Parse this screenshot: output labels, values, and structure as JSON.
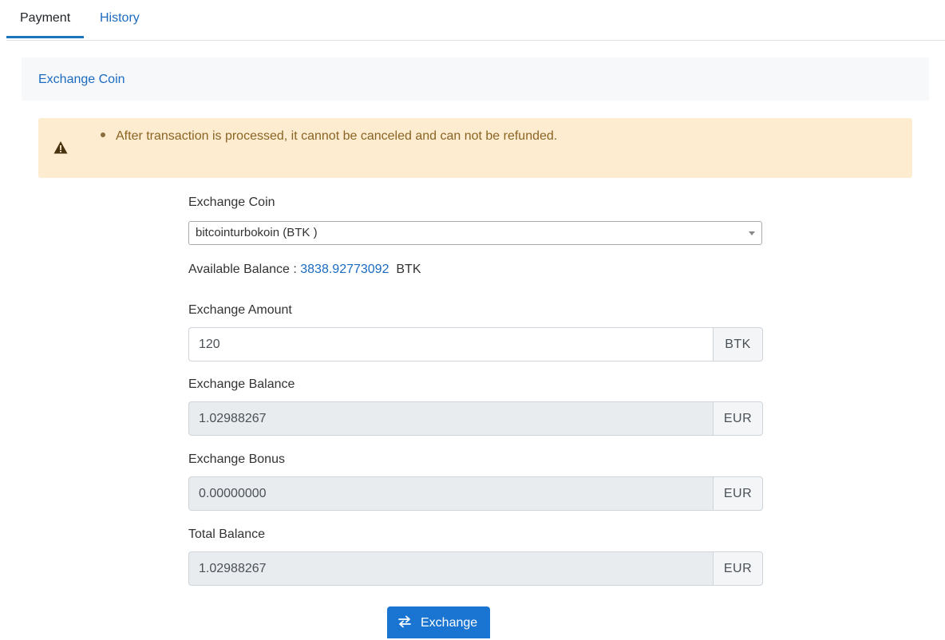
{
  "tabs": [
    {
      "label": "Payment",
      "active": true
    },
    {
      "label": "History",
      "active": false
    }
  ],
  "card": {
    "title": "Exchange Coin"
  },
  "alert": {
    "icon": "warning-triangle-icon",
    "message": "After transaction is processed, it cannot be canceled and can not be refunded."
  },
  "form": {
    "coin_label": "Exchange Coin",
    "coin_selected": "bitcointurbokoin (BTK )",
    "available_label": "Available Balance : ",
    "available_value": "3838.92773092",
    "available_unit": "BTK",
    "amount_label": "Exchange Amount",
    "amount_value": "120",
    "amount_unit": "BTK",
    "exchange_balance_label": "Exchange Balance",
    "exchange_balance_value": "1.02988267",
    "exchange_balance_unit": "EUR",
    "bonus_label": "Exchange Bonus",
    "bonus_value": "0.00000000",
    "bonus_unit": "EUR",
    "total_label": "Total Balance",
    "total_value": "1.02988267",
    "total_unit": "EUR"
  },
  "actions": {
    "exchange_label": "Exchange",
    "exchange_icon": "swap-arrows-icon"
  },
  "colors": {
    "link_blue": "#1b6bc0",
    "button_blue": "#1a74d2",
    "alert_bg": "#fdecd0",
    "alert_text": "#8a6424"
  }
}
